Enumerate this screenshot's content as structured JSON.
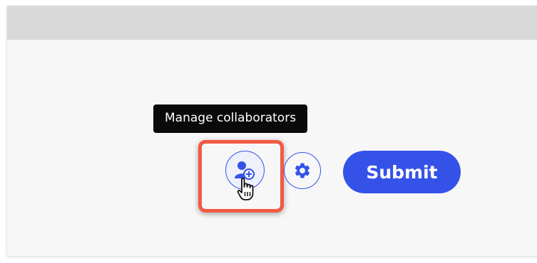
{
  "tooltip": {
    "text": "Manage collaborators"
  },
  "toolbar": {
    "manage_collaborators_icon": "user-plus-icon",
    "settings_icon": "gear-icon",
    "submit_label": "Submit"
  },
  "colors": {
    "accent": "#3552e8",
    "highlight": "#f15a44",
    "tooltip_bg": "#0a0a0a",
    "header_bg": "#d9d9d9",
    "page_bg": "#f7f7f7"
  }
}
